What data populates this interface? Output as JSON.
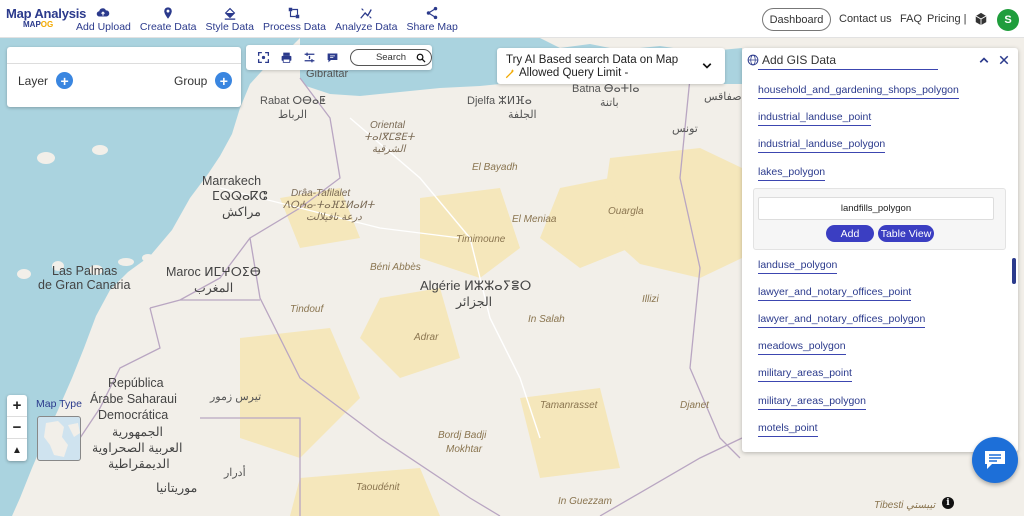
{
  "app": {
    "logo_title": "Map Analysis",
    "logo_sub_a": "MAP",
    "logo_sub_b": "OG"
  },
  "toolbar": {
    "items": [
      {
        "label": "Add Upload",
        "icon": "cloud-upload-icon"
      },
      {
        "label": "Create Data",
        "icon": "map-pin-icon"
      },
      {
        "label": "Style Data",
        "icon": "paint-bucket-icon"
      },
      {
        "label": "Process Data",
        "icon": "process-icon"
      },
      {
        "label": "Analyze Data",
        "icon": "analyze-icon"
      },
      {
        "label": "Share Map",
        "icon": "share-icon"
      }
    ]
  },
  "nav": {
    "dashboard": "Dashboard",
    "contact": "Contact us",
    "faq": "FAQ",
    "pricing": "Pricing |",
    "avatar_letter": "S"
  },
  "layer_panel": {
    "layer_label": "Layer",
    "group_label": "Group"
  },
  "map_tools": {
    "search_label": "Search"
  },
  "ai_search": {
    "line1": "Try AI Based search Data on Map",
    "line2": "Allowed Query Limit -"
  },
  "gis_panel": {
    "title": "Add GIS Data",
    "items_above": [
      "household_and_gardening_shops_polygon",
      "industrial_landuse_point",
      "industrial_landuse_polygon",
      "lakes_polygon"
    ],
    "selected": {
      "name": "landfills_polygon",
      "add_label": "Add",
      "table_label": "Table View"
    },
    "items_below": [
      "landuse_polygon",
      "lawyer_and_notary_offices_point",
      "lawyer_and_notary_offices_polygon",
      "meadows_polygon",
      "military_areas_point",
      "military_areas_polygon",
      "motels_point"
    ]
  },
  "map_controls": {
    "zoom_in": "+",
    "zoom_out": "−",
    "compass": "▲",
    "map_type_label": "Map Type"
  },
  "map_labels": {
    "gibraltar": "Gibraltar",
    "rabat": "Rabat ⵔⴱⴰⵟ",
    "rabat_ar": "الرباط",
    "oriental": "Oriental",
    "oriental_tz": "ⵜⴰⵏⴳⵎⵓⴹⵜ",
    "oriental_ar": "الشرقية",
    "djelfa": "Djelfa ⵣⵍⴼⴰ",
    "djelfa_ar": "الجلفة",
    "batna": "Batna ⴱⴰⵜⵏⴰ",
    "batna_ar": "باتنة",
    "sfax_ar": "صفاقس",
    "tunis_ar": "تونس",
    "marrakech": "Marrakech",
    "marrakech_tz": "ⵎⵕⵕⴰⴽⵛ",
    "marrakech_ar": "مراكش",
    "draa": "Drâa-Tafilalet",
    "draa_tz": "ⴷⵔⵄⴰ-ⵜⴰⴼⵉⵍⴰⵍⵜ",
    "draa_ar": "درعة تافيلالت",
    "el_bayadh": "El Bayadh",
    "el_meniaa": "El Meniaa",
    "ouargla": "Ouargla",
    "timimoune": "Timimoune",
    "las_palmas": "Las Palmas",
    "gran_canaria": "de Gran Canaria",
    "maroc": "Maroc ⵍⵎⵖⵔⵉⴱ",
    "maroc_ar": "المغرب",
    "beni_abbes": "Béni Abbès",
    "algerie": "Algérie ⵍⵣⵣⴰⵢⴻⵔ",
    "algerie_ar": "الجزائر",
    "illizi": "Illizi",
    "tindouf": "Tindouf",
    "adrar": "Adrar",
    "in_salah": "In Salah",
    "republica": "República",
    "arabe_saharaui": "Árabe Saharaui",
    "democratica": "Democrática",
    "ar_1": "الجمهورية",
    "ar_2": "العربية الصحراوية",
    "ar_3": "الديمقراطية",
    "tiris": "تيرس زمور",
    "adrar_ar": "أدرار",
    "mauritania_ar": "موريتانيا",
    "tamanrasset": "Tamanrasset",
    "djanet": "Djanet",
    "bordj": "Bordj Badji",
    "mokhtar": "Mokhtar",
    "taoudenit": "Taoudénit",
    "in_guezzam": "In Guezzam",
    "tibesti": "Tibesti تيبستي"
  },
  "colors": {
    "brand": "#2b3a8c",
    "accent_button": "#3b3ec2",
    "plus_button": "#3a86e0",
    "sea": "#aad3df",
    "land": "#f2efe9",
    "desert": "#f5e7bb"
  }
}
